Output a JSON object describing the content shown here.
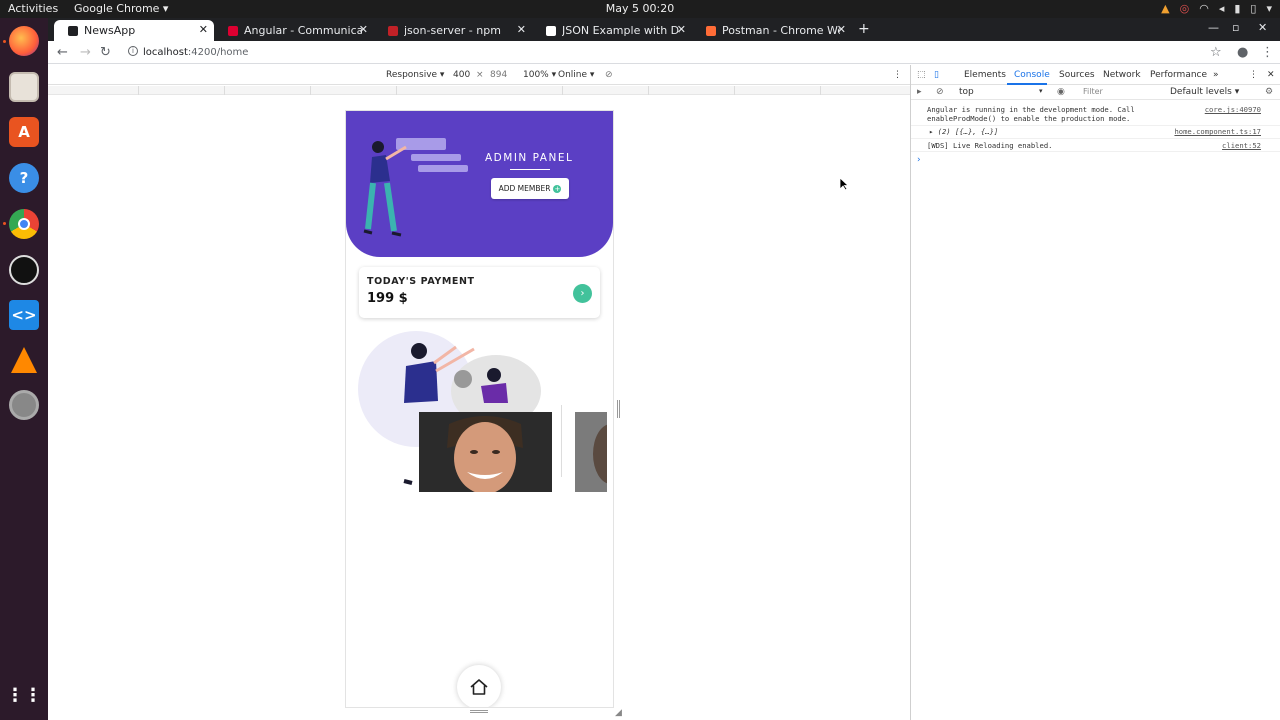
{
  "system": {
    "activities": "Activities",
    "app_menu": "Google Chrome ▾",
    "clock": "May 5  00:20"
  },
  "browser": {
    "tabs": [
      {
        "label": "NewsApp",
        "icon_color": "#202124",
        "active": true
      },
      {
        "label": "Angular - Communicating",
        "icon_color": "#dd0031",
        "active": false
      },
      {
        "label": "json-server - npm",
        "icon_color": "#c12127",
        "active": false
      },
      {
        "label": "JSON Example with Data",
        "icon_color": "#ffffff",
        "active": false
      },
      {
        "label": "Postman - Chrome Web S",
        "icon_color": "#ff6c37",
        "active": false
      }
    ],
    "url_host": "localhost",
    "url_path": ":4200/home"
  },
  "device_toolbar": {
    "preset": "Responsive ▾",
    "width": "400",
    "times": "×",
    "height": "894",
    "zoom": "100% ▾",
    "network": "Online ▾"
  },
  "app": {
    "admin_title": "ADMIN PANEL",
    "add_member_label": "ADD MEMBER",
    "payment_title": "TODAY'S PAYMENT",
    "payment_amount": "199 $",
    "colors": {
      "primary": "#5b3fc4",
      "accent": "#42c29b"
    }
  },
  "devtools": {
    "tabs": [
      "Elements",
      "Console",
      "Sources",
      "Network",
      "Performance"
    ],
    "active_tab": "Console",
    "context": "top",
    "filter_placeholder": "Filter",
    "levels": "Default levels ▾",
    "logs": [
      {
        "text": "Angular is running in the development mode. Call",
        "text2": "enableProdMode() to enable the production mode.",
        "source": "core.js:40970"
      },
      {
        "text": "▸ (2) [{…}, {…}]",
        "source": "home.component.ts:17"
      },
      {
        "text": "[WDS] Live Reloading enabled.",
        "source": "client:52"
      }
    ]
  }
}
